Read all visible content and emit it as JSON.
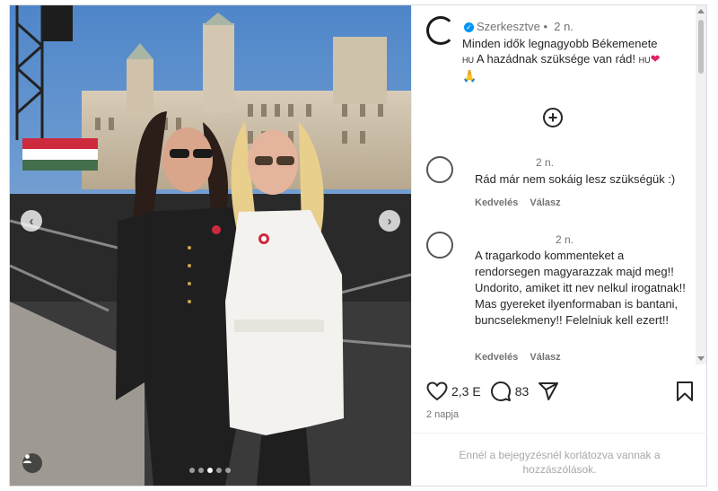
{
  "post": {
    "author": "Szerkesztve",
    "separator": "•",
    "time": "2 n.",
    "caption_line1": "Minden idők legnagyobb Békemenete",
    "caption_flag": "HU",
    "caption_line2": "A hazádnak szüksége van rád!",
    "caption_flag2": "HU"
  },
  "add_comment_icon": "plus-circle-icon",
  "comments": [
    {
      "time": "2 n.",
      "text": "Rád már nem sokáig lesz szükségük :)",
      "like_label": "Kedvelés",
      "reply_label": "Válasz"
    },
    {
      "time": "2 n.",
      "text": "A tragarkodo kommenteket a rendorsegen magyarazzak majd meg!! Undorito, amiket itt nev nelkul irogatnak!! Mas gyereket ilyenformaban is bantani, buncselekmeny!! Felelniuk kell ezert!!",
      "like_label": "Kedvelés",
      "reply_label": "Válasz"
    }
  ],
  "stats": {
    "likes": "2,3 E",
    "comments": "83",
    "posted_ago": "2 napja"
  },
  "restricted_notice": "Ennél a bejegyzésnél korlátozva vannak a hozzászólások.",
  "carousel": {
    "slide_count": 5,
    "active_slide": 3
  },
  "colors": {
    "accent": "#0095f6",
    "heart": "#e0245e",
    "text": "#262626",
    "muted": "#737373"
  }
}
